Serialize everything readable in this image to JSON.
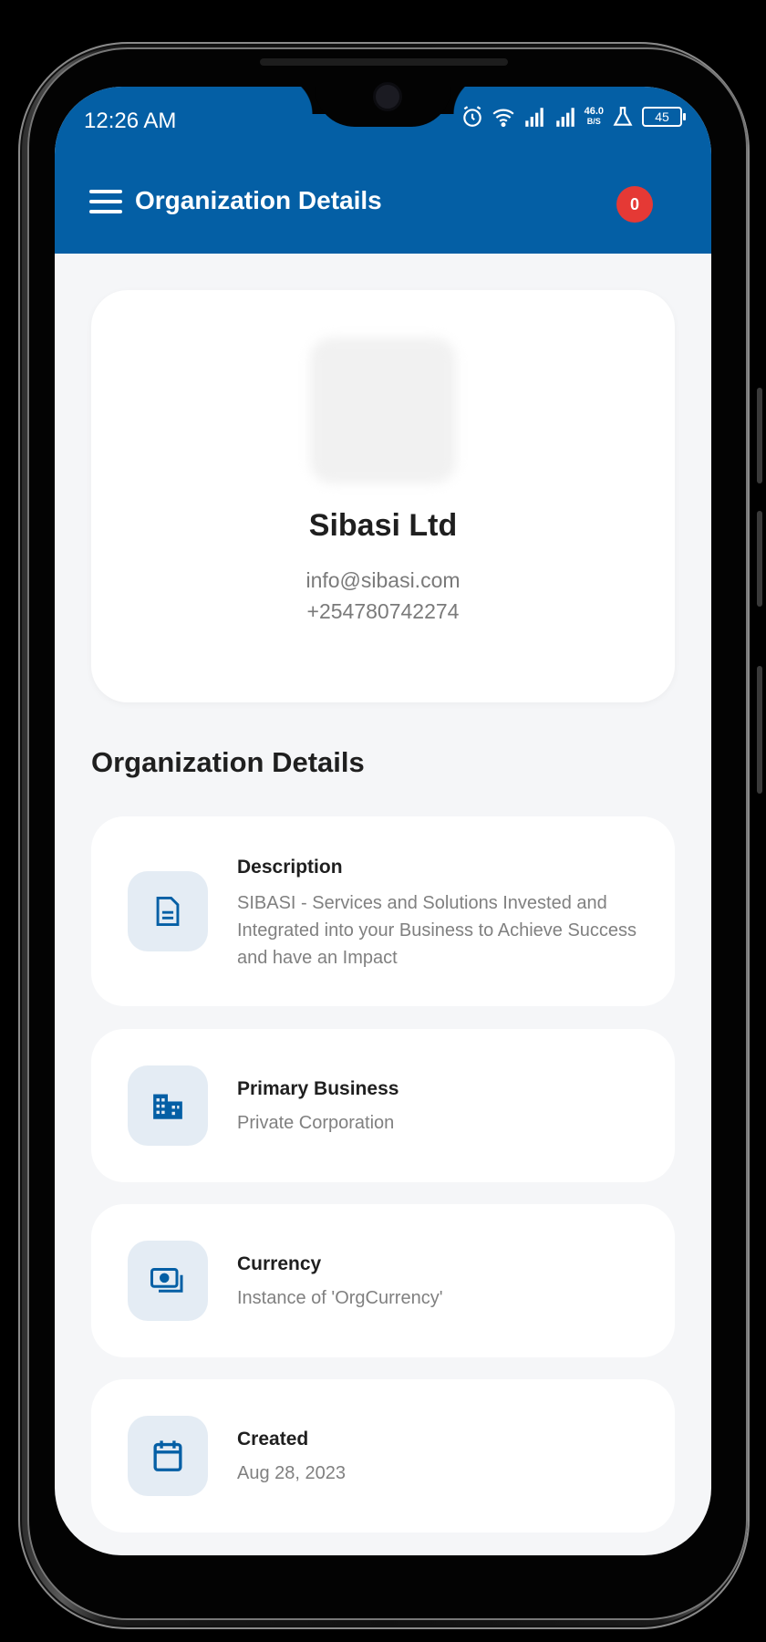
{
  "status_bar": {
    "time": "12:26 AM",
    "net_speed_value": "46.0",
    "net_speed_unit": "B/S",
    "battery": "45"
  },
  "app_bar": {
    "title": "Organization Details",
    "notification_count": "0"
  },
  "profile": {
    "name": "Sibasi Ltd",
    "email": "info@sibasi.com",
    "phone": "+254780742274"
  },
  "section": {
    "title": "Organization Details"
  },
  "details": [
    {
      "label": "Description",
      "value": "SIBASI - Services and Solutions Invested and Integrated into your Business to Achieve Success and have an Impact",
      "icon": "document-icon"
    },
    {
      "label": "Primary Business",
      "value": "Private Corporation",
      "icon": "building-icon"
    },
    {
      "label": "Currency",
      "value": "Instance of 'OrgCurrency'",
      "icon": "money-icon"
    },
    {
      "label": "Created",
      "value": "Aug 28, 2023",
      "icon": "calendar-icon"
    }
  ],
  "colors": {
    "primary": "#045fa5",
    "badge": "#e53935",
    "icon_bg": "#e4ecf4",
    "page_bg": "#f5f6f8"
  }
}
